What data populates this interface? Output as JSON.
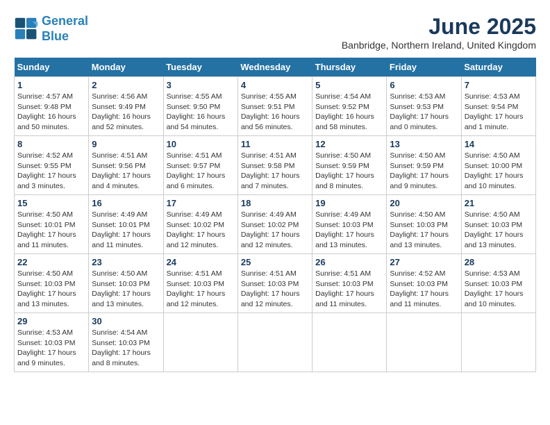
{
  "header": {
    "logo_line1": "General",
    "logo_line2": "Blue",
    "title": "June 2025",
    "subtitle": "Banbridge, Northern Ireland, United Kingdom"
  },
  "calendar": {
    "days_of_week": [
      "Sunday",
      "Monday",
      "Tuesday",
      "Wednesday",
      "Thursday",
      "Friday",
      "Saturday"
    ],
    "weeks": [
      [
        {
          "day": 1,
          "info": "Sunrise: 4:57 AM\nSunset: 9:48 PM\nDaylight: 16 hours\nand 50 minutes."
        },
        {
          "day": 2,
          "info": "Sunrise: 4:56 AM\nSunset: 9:49 PM\nDaylight: 16 hours\nand 52 minutes."
        },
        {
          "day": 3,
          "info": "Sunrise: 4:55 AM\nSunset: 9:50 PM\nDaylight: 16 hours\nand 54 minutes."
        },
        {
          "day": 4,
          "info": "Sunrise: 4:55 AM\nSunset: 9:51 PM\nDaylight: 16 hours\nand 56 minutes."
        },
        {
          "day": 5,
          "info": "Sunrise: 4:54 AM\nSunset: 9:52 PM\nDaylight: 16 hours\nand 58 minutes."
        },
        {
          "day": 6,
          "info": "Sunrise: 4:53 AM\nSunset: 9:53 PM\nDaylight: 17 hours\nand 0 minutes."
        },
        {
          "day": 7,
          "info": "Sunrise: 4:53 AM\nSunset: 9:54 PM\nDaylight: 17 hours\nand 1 minute."
        }
      ],
      [
        {
          "day": 8,
          "info": "Sunrise: 4:52 AM\nSunset: 9:55 PM\nDaylight: 17 hours\nand 3 minutes."
        },
        {
          "day": 9,
          "info": "Sunrise: 4:51 AM\nSunset: 9:56 PM\nDaylight: 17 hours\nand 4 minutes."
        },
        {
          "day": 10,
          "info": "Sunrise: 4:51 AM\nSunset: 9:57 PM\nDaylight: 17 hours\nand 6 minutes."
        },
        {
          "day": 11,
          "info": "Sunrise: 4:51 AM\nSunset: 9:58 PM\nDaylight: 17 hours\nand 7 minutes."
        },
        {
          "day": 12,
          "info": "Sunrise: 4:50 AM\nSunset: 9:59 PM\nDaylight: 17 hours\nand 8 minutes."
        },
        {
          "day": 13,
          "info": "Sunrise: 4:50 AM\nSunset: 9:59 PM\nDaylight: 17 hours\nand 9 minutes."
        },
        {
          "day": 14,
          "info": "Sunrise: 4:50 AM\nSunset: 10:00 PM\nDaylight: 17 hours\nand 10 minutes."
        }
      ],
      [
        {
          "day": 15,
          "info": "Sunrise: 4:50 AM\nSunset: 10:01 PM\nDaylight: 17 hours\nand 11 minutes."
        },
        {
          "day": 16,
          "info": "Sunrise: 4:49 AM\nSunset: 10:01 PM\nDaylight: 17 hours\nand 11 minutes."
        },
        {
          "day": 17,
          "info": "Sunrise: 4:49 AM\nSunset: 10:02 PM\nDaylight: 17 hours\nand 12 minutes."
        },
        {
          "day": 18,
          "info": "Sunrise: 4:49 AM\nSunset: 10:02 PM\nDaylight: 17 hours\nand 12 minutes."
        },
        {
          "day": 19,
          "info": "Sunrise: 4:49 AM\nSunset: 10:03 PM\nDaylight: 17 hours\nand 13 minutes."
        },
        {
          "day": 20,
          "info": "Sunrise: 4:50 AM\nSunset: 10:03 PM\nDaylight: 17 hours\nand 13 minutes."
        },
        {
          "day": 21,
          "info": "Sunrise: 4:50 AM\nSunset: 10:03 PM\nDaylight: 17 hours\nand 13 minutes."
        }
      ],
      [
        {
          "day": 22,
          "info": "Sunrise: 4:50 AM\nSunset: 10:03 PM\nDaylight: 17 hours\nand 13 minutes."
        },
        {
          "day": 23,
          "info": "Sunrise: 4:50 AM\nSunset: 10:03 PM\nDaylight: 17 hours\nand 13 minutes."
        },
        {
          "day": 24,
          "info": "Sunrise: 4:51 AM\nSunset: 10:03 PM\nDaylight: 17 hours\nand 12 minutes."
        },
        {
          "day": 25,
          "info": "Sunrise: 4:51 AM\nSunset: 10:03 PM\nDaylight: 17 hours\nand 12 minutes."
        },
        {
          "day": 26,
          "info": "Sunrise: 4:51 AM\nSunset: 10:03 PM\nDaylight: 17 hours\nand 11 minutes."
        },
        {
          "day": 27,
          "info": "Sunrise: 4:52 AM\nSunset: 10:03 PM\nDaylight: 17 hours\nand 11 minutes."
        },
        {
          "day": 28,
          "info": "Sunrise: 4:53 AM\nSunset: 10:03 PM\nDaylight: 17 hours\nand 10 minutes."
        }
      ],
      [
        {
          "day": 29,
          "info": "Sunrise: 4:53 AM\nSunset: 10:03 PM\nDaylight: 17 hours\nand 9 minutes."
        },
        {
          "day": 30,
          "info": "Sunrise: 4:54 AM\nSunset: 10:03 PM\nDaylight: 17 hours\nand 8 minutes."
        },
        null,
        null,
        null,
        null,
        null
      ]
    ]
  }
}
